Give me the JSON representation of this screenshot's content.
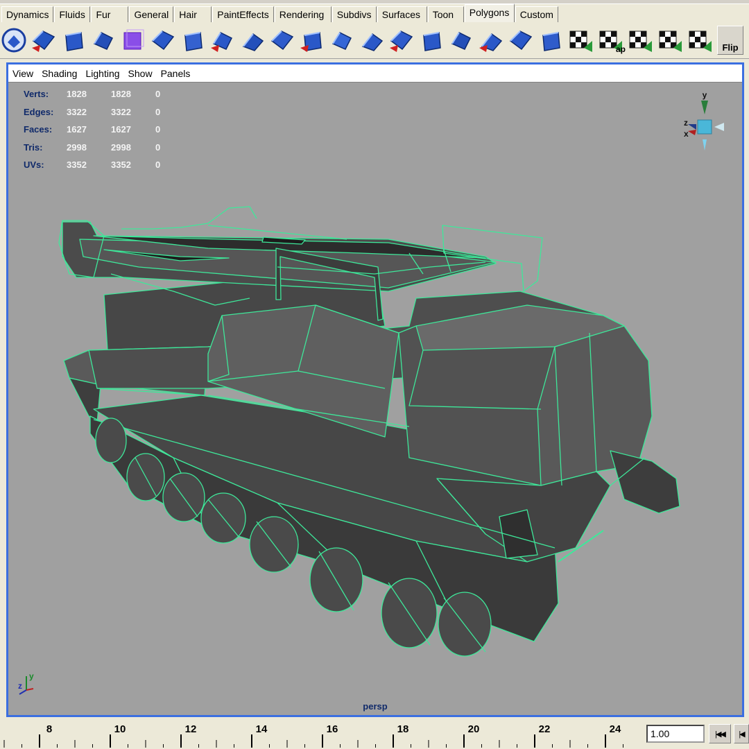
{
  "shelf_tabs": [
    "Dynamics",
    "Fluids",
    "Fur",
    "General",
    "Hair",
    "PaintEffects",
    "Rendering",
    "Subdivs",
    "Surfaces",
    "Toon",
    "Polygons",
    "Custom"
  ],
  "active_tab": "Polygons",
  "shelf_tools": [
    "select-poly-icon",
    "split-poly-icon",
    "sphere-poly-icon",
    "sphere-faces-icon",
    "cube-wire-icon",
    "cut-faces-icon",
    "split-edge-icon",
    "extrude-face-icon",
    "extrude-edge-icon",
    "wedge-face-icon",
    "bevel-icon",
    "duplicate-face-icon",
    "merge-vertices-icon",
    "collapse-icon",
    "subdivide-icon",
    "smooth-icon",
    "append-poly-icon",
    "mirror-icon",
    "planar-map-icon",
    "uv-cylindrical-icon",
    "uv-automatic-icon",
    "uv-spherical-icon",
    "uv-texture-editor-icon",
    "uv-layout-icon"
  ],
  "shelf_tool_partial_text": "ap",
  "flip_label": "Flip",
  "panel_menu": [
    "View",
    "Shading",
    "Lighting",
    "Show",
    "Panels"
  ],
  "hud": [
    {
      "label": "Verts:",
      "a": "1828",
      "b": "1828",
      "c": "0"
    },
    {
      "label": "Edges:",
      "a": "3322",
      "b": "3322",
      "c": "0"
    },
    {
      "label": "Faces:",
      "a": "1627",
      "b": "1627",
      "c": "0"
    },
    {
      "label": "Tris:",
      "a": "2998",
      "b": "2998",
      "c": "0"
    },
    {
      "label": "UVs:",
      "a": "3352",
      "b": "3352",
      "c": "0"
    }
  ],
  "view_cube_axes": {
    "y": "y",
    "z": "z",
    "x": "x"
  },
  "axis_indicator": {
    "y": "y",
    "z": "z"
  },
  "camera_name": "persp",
  "time_slider": {
    "labels": [
      "8",
      "10",
      "12",
      "14",
      "16",
      "18",
      "20",
      "22",
      "24"
    ]
  },
  "current_frame": "1.00",
  "colors": {
    "viewport_bg": "#a0a0a0",
    "wireframe": "#3ee89a",
    "panel_border": "#3b6fe0",
    "hud_label": "#102a6a",
    "hud_value": "#f4f4f4"
  }
}
